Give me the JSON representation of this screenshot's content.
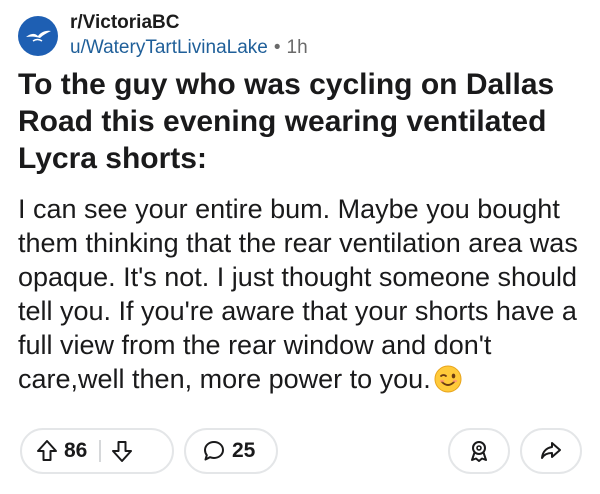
{
  "post": {
    "subreddit": "r/VictoriaBC",
    "author": "u/WateryTartLivinaLake",
    "separator": "•",
    "age": "1h",
    "title": "To the guy who was cycling on Dallas Road this evening wearing ventilated Lycra shorts:",
    "body": "I can see your entire bum. Maybe you bought them thinking that the rear ventilation area was opaque. It's not. I just thought someone should tell you. If you're aware that your shorts have a full view from the rear window and don't care,well then, more power to you.",
    "body_emoji": "winking-face-emoji"
  },
  "actions": {
    "upvote_count": "86",
    "comment_count": "25",
    "icons": {
      "upvote": "upvote-arrow-icon",
      "downvote": "downvote-arrow-icon",
      "comment": "comment-bubble-icon",
      "award": "award-icon",
      "share": "share-arrow-icon"
    }
  },
  "colors": {
    "avatar_bg": "#1e5fb3",
    "author_link": "#1f5f99",
    "text": "#1a1a1b",
    "pill_border": "#e4e6e8"
  }
}
